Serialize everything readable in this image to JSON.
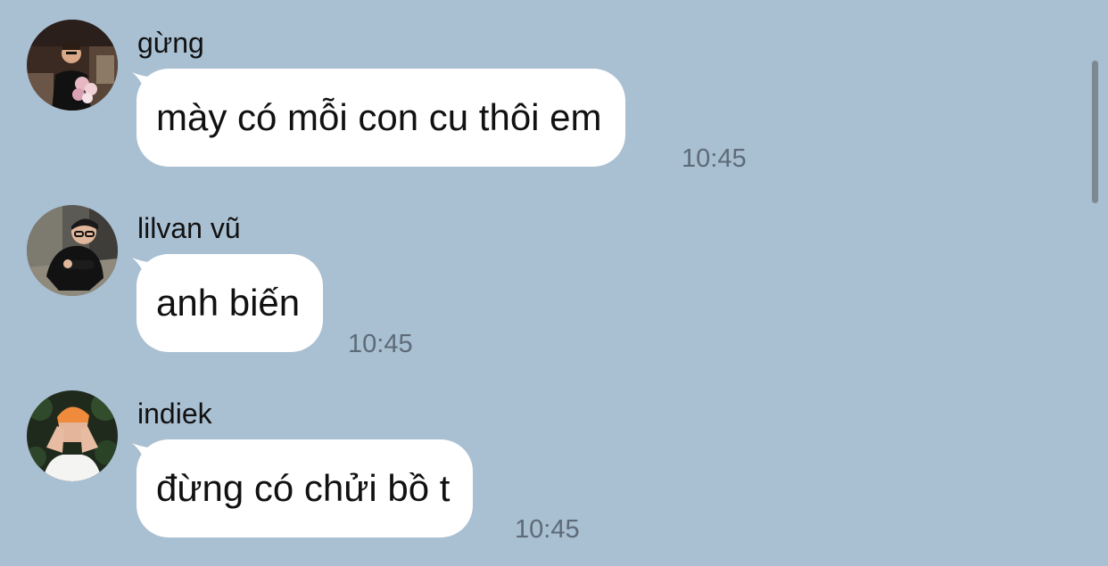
{
  "messages": [
    {
      "sender": "gừng",
      "text": "mày có mỗi con cu thôi em",
      "time": "10:45",
      "avatar_icon": "avatar-gung-icon"
    },
    {
      "sender": "lilvan vũ",
      "text": "anh biến",
      "time": "10:45",
      "avatar_icon": "avatar-lilvan-icon"
    },
    {
      "sender": "indiek",
      "text": "đừng có chửi bồ t",
      "time": "10:45",
      "avatar_icon": "avatar-indiek-icon"
    }
  ],
  "colors": {
    "background": "#a9bfd2",
    "bubble": "#ffffff",
    "time": "#5d6b78",
    "scrollbar": "#7d8891"
  }
}
